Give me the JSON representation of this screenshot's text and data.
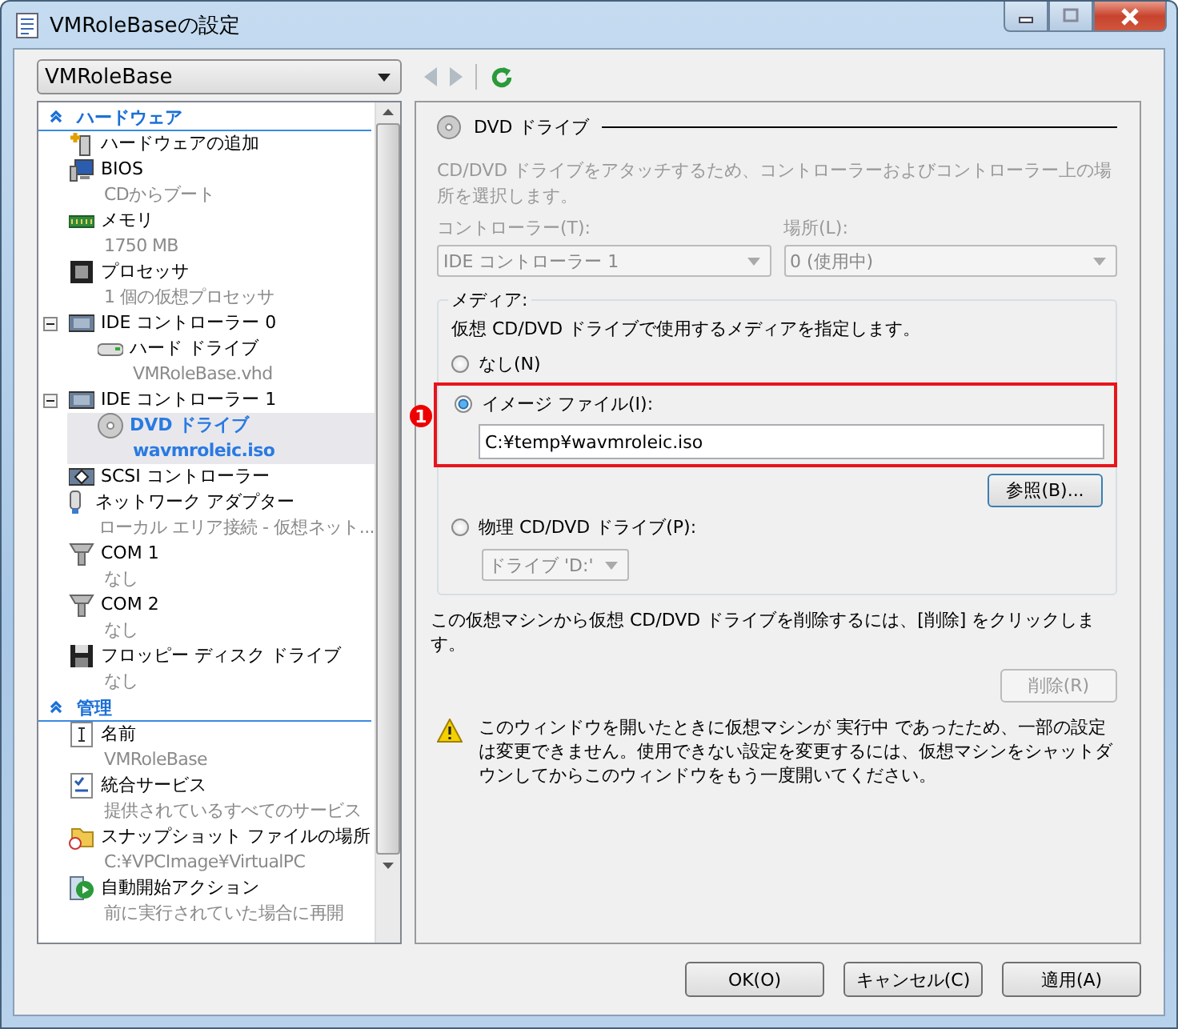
{
  "window": {
    "title": "VMRoleBaseの設定"
  },
  "vm_selector": {
    "value": "VMRoleBase"
  },
  "nav": {
    "back_disabled": true,
    "forward_disabled": true
  },
  "tree": {
    "sections": [
      {
        "label": "ハードウェア",
        "expanded": true,
        "items": [
          {
            "kind": "add",
            "label": "ハードウェアの追加",
            "selected": false
          },
          {
            "kind": "bios",
            "label": "BIOS",
            "sub": "CDからブート",
            "selected": false
          },
          {
            "kind": "memory",
            "label": "メモリ",
            "sub": "1750 MB",
            "selected": false
          },
          {
            "kind": "cpu",
            "label": "プロセッサ",
            "sub": "1 個の仮想プロセッサ",
            "selected": false
          },
          {
            "kind": "controller",
            "label": "IDE コントローラー 0",
            "selected": false,
            "expanded": true,
            "children": [
              {
                "kind": "disk",
                "label": "ハード ドライブ",
                "sub": "VMRoleBase.vhd",
                "selected": false
              }
            ]
          },
          {
            "kind": "controller",
            "label": "IDE コントローラー 1",
            "selected": false,
            "expanded": true,
            "children": [
              {
                "kind": "dvd",
                "label": "DVD ドライブ",
                "sub": "wavmroleic.iso",
                "selected": true
              }
            ]
          },
          {
            "kind": "scsi",
            "label": "SCSI コントローラー",
            "selected": false
          },
          {
            "kind": "network",
            "label": "ネットワーク アダプター",
            "sub": "ローカル エリア接続 - 仮想ネット...",
            "selected": false
          },
          {
            "kind": "com",
            "label": "COM 1",
            "sub": "なし",
            "selected": false
          },
          {
            "kind": "com",
            "label": "COM 2",
            "sub": "なし",
            "selected": false
          },
          {
            "kind": "floppy",
            "label": "フロッピー ディスク ドライブ",
            "sub": "なし",
            "selected": false
          }
        ]
      },
      {
        "label": "管理",
        "expanded": true,
        "items": [
          {
            "kind": "name",
            "label": "名前",
            "sub": "VMRoleBase",
            "selected": false
          },
          {
            "kind": "services",
            "label": "統合サービス",
            "sub": "提供されているすべてのサービス",
            "selected": false
          },
          {
            "kind": "snapshot",
            "label": "スナップショット ファイルの場所",
            "sub": "C:¥VPCImage¥VirtualPC",
            "selected": false
          },
          {
            "kind": "autostart",
            "label": "自動開始アクション",
            "sub": "前に実行されていた場合に再開",
            "selected": false
          }
        ]
      }
    ]
  },
  "settings": {
    "heading": "DVD ドライブ",
    "description": "CD/DVD ドライブをアタッチするため、コントローラーおよびコントローラー上の場所を選択します。",
    "controller": {
      "label": "コントローラー(T):",
      "value": "IDE コントローラー 1",
      "disabled": true
    },
    "location": {
      "label": "場所(L):",
      "value": "0 (使用中)",
      "disabled": true
    },
    "media": {
      "label": "メディア:",
      "hint": "仮想 CD/DVD ドライブで使用するメディアを指定します。",
      "options": [
        {
          "kind": "none",
          "label": "なし(N)",
          "selected": false
        },
        {
          "kind": "image",
          "label": "イメージ ファイル(I):",
          "selected": true,
          "value": "C:¥temp¥wavmroleic.iso",
          "badge": "1",
          "browse": "参照(B)..."
        },
        {
          "kind": "physical",
          "label": "物理 CD/DVD ドライブ(P):",
          "selected": false,
          "drive": "ドライブ 'D:'",
          "drive_disabled": true
        }
      ]
    },
    "remove_note": "この仮想マシンから仮想 CD/DVD ドライブを削除するには、[削除] をクリックします。",
    "remove_button": {
      "label": "削除(R)",
      "disabled": true
    },
    "warning": "このウィンドウを開いたときに仮想マシンが 実行中 であったため、一部の設定は変更できません。使用できない設定を変更するには、仮想マシンをシャットダウンしてからこのウィンドウをもう一度開いてください。"
  },
  "buttons": [
    {
      "label": "OK(O)",
      "disabled": false
    },
    {
      "label": "キャンセル(C)",
      "disabled": false
    },
    {
      "label": "適用(A)",
      "disabled": false
    }
  ]
}
